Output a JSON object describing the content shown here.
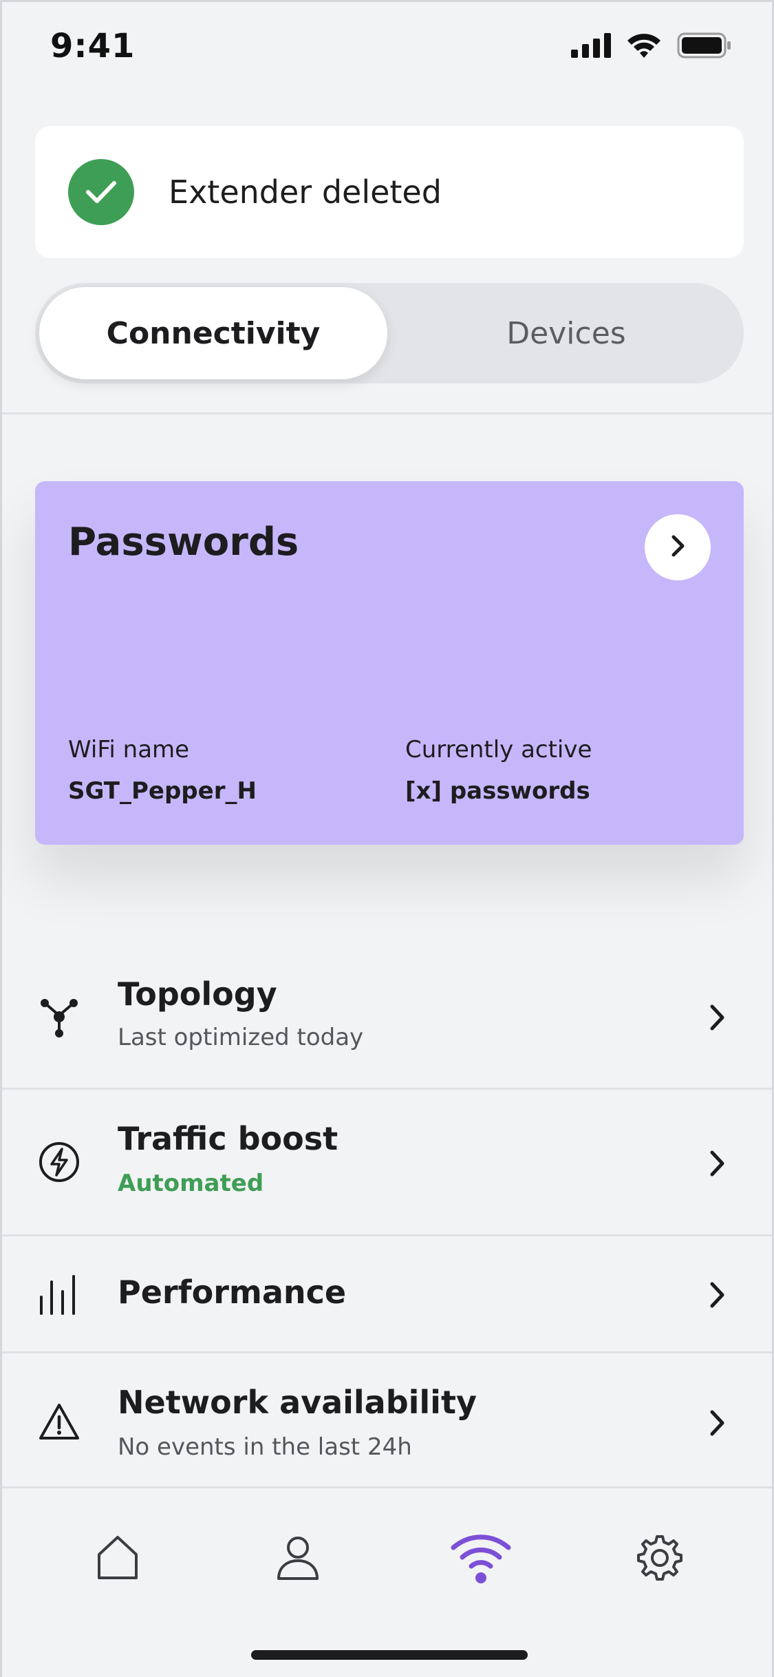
{
  "status_bar": {
    "time": "9:41"
  },
  "toast": {
    "message": "Extender deleted"
  },
  "segmented": {
    "active": "Connectivity",
    "inactive": "Devices"
  },
  "card": {
    "title": "Passwords",
    "wifi_label": "WiFi name",
    "wifi_value": "SGT_Pepper_H",
    "active_label": "Currently active",
    "active_value": "[x] passwords",
    "background_color": "#c6b7fb"
  },
  "list": {
    "items": [
      {
        "title": "Topology",
        "subtitle": "Last optimized today",
        "icon": "topology-icon"
      },
      {
        "title": "Traffic boost",
        "subtitle": "Automated",
        "icon": "lightning-icon"
      },
      {
        "title": "Performance",
        "subtitle": "",
        "icon": "bar-chart-icon"
      },
      {
        "title": "Network availability",
        "subtitle": "No events in the last 24h",
        "icon": "warning-icon"
      }
    ]
  },
  "tab_bar": {
    "tabs": [
      "home-icon",
      "profile-icon",
      "wifi-icon",
      "settings-icon"
    ],
    "active_color": "#7b4fd6"
  },
  "colors": {
    "success": "#3f9e55",
    "accent": "#7b4fd6"
  }
}
